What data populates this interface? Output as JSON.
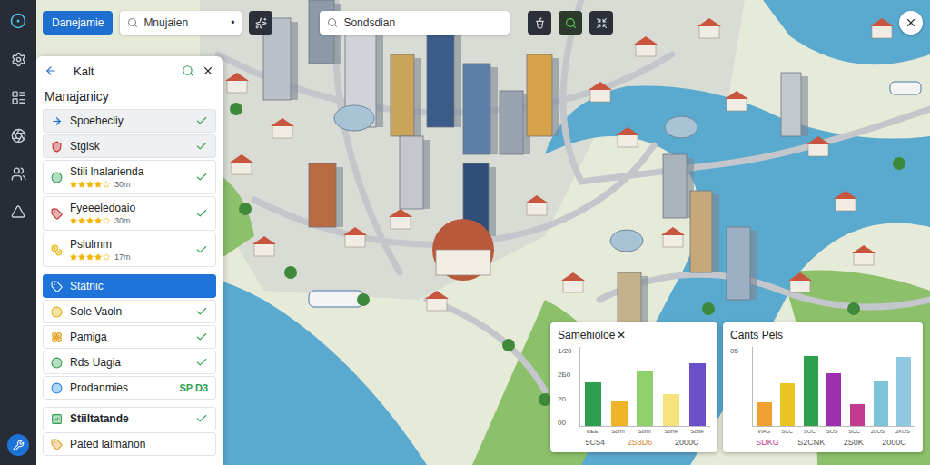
{
  "toolbar": {
    "primary_button": "Danejamie",
    "search_left": {
      "value": "Mnujaien",
      "marker": "•"
    },
    "search_center": {
      "value": "Sondsdian"
    }
  },
  "panel": {
    "title": "Kalt",
    "heading": "Manajanicy",
    "items": [
      {
        "label": "Spoehecliy",
        "kind": "row",
        "checked": true,
        "shaded": true,
        "selected": false,
        "color": "#1e73d8"
      },
      {
        "label": "Stgisk",
        "kind": "row",
        "checked": true,
        "shaded": true,
        "selected": false,
        "color": "#c62828"
      },
      {
        "label": "Stili lnalarienda",
        "kind": "rated",
        "stars": 4,
        "meta": "30m",
        "checked": true,
        "shaded": false,
        "selected": false,
        "color": "#2e9e4f"
      },
      {
        "label": "Fyeeeledoaio",
        "kind": "rated",
        "stars": 4,
        "meta": "30m",
        "checked": true,
        "shaded": false,
        "selected": false,
        "color": "#c62828"
      },
      {
        "label": "Pslulmm",
        "kind": "rated",
        "stars": 4,
        "meta": "17m",
        "checked": true,
        "shaded": false,
        "selected": false,
        "color": "#e0b400"
      },
      {
        "label": "Statnic",
        "kind": "section",
        "checked": false,
        "shaded": false,
        "selected": true,
        "color": "#2e9e4f"
      },
      {
        "label": "Sole Vaoln",
        "kind": "row",
        "checked": true,
        "shaded": false,
        "selected": false,
        "color": "#e0b400"
      },
      {
        "label": "Pamiga",
        "kind": "row",
        "checked": true,
        "shaded": false,
        "selected": false,
        "color": "#e0a020"
      },
      {
        "label": "Rds Uagia",
        "kind": "row",
        "checked": true,
        "shaded": false,
        "selected": false,
        "color": "#2e9e4f"
      },
      {
        "label": "Prodanmies",
        "kind": "value",
        "value": "SP D3",
        "checked": false,
        "shaded": false,
        "selected": false,
        "color": "#1e88e5"
      },
      {
        "label": "Stiiltatande",
        "kind": "section",
        "checked": true,
        "shaded": false,
        "selected": false,
        "color": "#2e9e4f"
      },
      {
        "label": "Pated lalmanon",
        "kind": "row",
        "checked": false,
        "shaded": false,
        "selected": false,
        "color": "#e0a020"
      }
    ]
  },
  "charts": [
    {
      "title": "Samehioloe",
      "close": "✕",
      "ticks": [
        "1/20",
        "2Б0",
        "20",
        "00"
      ],
      "bars": [
        {
          "label": "ViEE",
          "value": 54,
          "color": "#2e9e4f"
        },
        {
          "label": "Sorm",
          "value": 32,
          "color": "#f0b429"
        },
        {
          "label": "Sorm",
          "value": 69,
          "color": "#8fd16a"
        },
        {
          "label": "Sorfe",
          "value": 40,
          "color": "#f5e27a"
        },
        {
          "label": "Sotte",
          "value": 78,
          "color": "#6a4fc9"
        }
      ],
      "footer": [
        {
          "text": "5C54",
          "color": "#555555"
        },
        {
          "text": "2S3D6",
          "color": "#d98a1c"
        },
        {
          "text": "2000C",
          "color": "#555555"
        }
      ]
    },
    {
      "title": "Cants Pels",
      "close": "",
      "ticks": [
        "05"
      ],
      "bars": [
        {
          "label": "VIAG",
          "value": 30,
          "color": "#f0a030"
        },
        {
          "label": "SCC",
          "value": 53,
          "color": "#e8c520"
        },
        {
          "label": "SOC",
          "value": 87,
          "color": "#2e9e4f"
        },
        {
          "label": "SOS",
          "value": 66,
          "color": "#9b2fae"
        },
        {
          "label": "SCC",
          "value": 27,
          "color": "#c23b8c"
        },
        {
          "label": "20OS",
          "value": 57,
          "color": "#7cc4d8"
        },
        {
          "label": "2KOS",
          "value": 86,
          "color": "#8fc8e0"
        }
      ],
      "footer": [
        {
          "text": "SDKG",
          "color": "#c23b8c"
        },
        {
          "text": "S2CNK",
          "color": "#555555"
        },
        {
          "text": "2S0K",
          "color": "#555555"
        },
        {
          "text": "2000C",
          "color": "#555555"
        }
      ]
    }
  ]
}
